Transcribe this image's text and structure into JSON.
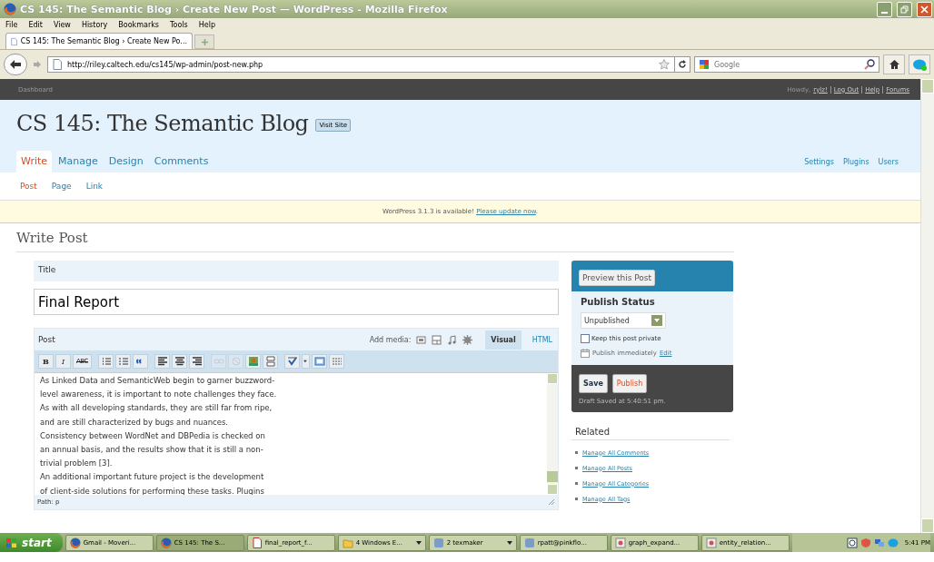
{
  "window": {
    "title": "CS 145: The Semantic Blog › Create New Post — WordPress - Mozilla Firefox"
  },
  "menu": [
    "File",
    "Edit",
    "View",
    "History",
    "Bookmarks",
    "Tools",
    "Help"
  ],
  "tabs": [
    {
      "label": "CS 145: The Semantic Blog › Create New Po...",
      "selected": true
    }
  ],
  "address": {
    "url": "http://riley.caltech.edu/cs145/wp-admin/post-new.php"
  },
  "search": {
    "placeholder": "Google"
  },
  "admin_bar": {
    "dashboard": "Dashboard",
    "greeting": "Howdy,",
    "user": "rylz!",
    "links": [
      "Log Out",
      "Help",
      "Forums"
    ]
  },
  "header": {
    "blog_title": "CS 145: The Semantic Blog",
    "visit_site": "Visit Site"
  },
  "nav_tabs": [
    {
      "label": "Write",
      "selected": true
    },
    {
      "label": "Manage",
      "selected": false
    },
    {
      "label": "Design",
      "selected": false
    },
    {
      "label": "Comments",
      "selected": false
    }
  ],
  "nav_right": [
    "Settings",
    "Plugins",
    "Users"
  ],
  "sub_tabs": [
    {
      "label": "Post",
      "selected": true
    },
    {
      "label": "Page",
      "selected": false
    },
    {
      "label": "Link",
      "selected": false
    }
  ],
  "notice": {
    "text": "WordPress 3.1.3 is available!",
    "link": "Please update now",
    "end": "."
  },
  "page_heading": "Write Post",
  "title_box": {
    "label": "Title",
    "value": "Final Report"
  },
  "post_box": {
    "label": "Post",
    "add_media": "Add media:",
    "editor_tabs": [
      {
        "label": "Visual",
        "selected": true
      },
      {
        "label": "HTML",
        "selected": false
      }
    ],
    "toolbar": [
      {
        "kind": "bold",
        "label": "B",
        "disabled": false
      },
      {
        "kind": "italic",
        "label": "I",
        "disabled": false
      },
      {
        "kind": "strike",
        "label": "ABC",
        "disabled": false
      },
      {
        "kind": "sep"
      },
      {
        "kind": "ul",
        "disabled": false
      },
      {
        "kind": "ol",
        "disabled": false
      },
      {
        "kind": "quote",
        "disabled": false
      },
      {
        "kind": "sep"
      },
      {
        "kind": "left",
        "disabled": false
      },
      {
        "kind": "center",
        "disabled": false
      },
      {
        "kind": "right",
        "disabled": false
      },
      {
        "kind": "sep"
      },
      {
        "kind": "link",
        "disabled": true
      },
      {
        "kind": "unlink",
        "disabled": true
      },
      {
        "kind": "image",
        "disabled": false
      },
      {
        "kind": "more",
        "disabled": false
      },
      {
        "kind": "sep"
      },
      {
        "kind": "spell",
        "disabled": false
      },
      {
        "kind": "caret",
        "disabled": false
      },
      {
        "kind": "fullscreen",
        "disabled": false
      },
      {
        "kind": "kitchen",
        "disabled": false
      }
    ],
    "lines": [
      "As Linked Data and SemanticWeb begin to garner buzzword-",
      "level awareness, it is important to note challenges they face.",
      "As with all developing standards, they are still far from ripe,",
      "and are still characterized by bugs and nuances.",
      "Consistency between WordNet and DBPedia is checked on",
      "an annual basis, and the results show that it is still a non-",
      "trivial problem [3].",
      "An additional important future project is the development",
      "of client-side solutions for performing these tasks. Plugins"
    ],
    "path": "Path: p"
  },
  "publish": {
    "preview": "Preview this Post",
    "heading": "Publish Status",
    "status": "Unpublished",
    "private": {
      "label": "Keep this post private",
      "checked": false
    },
    "schedule": "Publish immediately",
    "edit": "Edit",
    "save": "Save",
    "publish": "Publish",
    "draft_saved": "Draft Saved at 5:40:51 pm."
  },
  "related": {
    "heading": "Related",
    "links": [
      "Manage All Comments",
      "Manage All Posts",
      "Manage All Categories",
      "Manage All Tags"
    ]
  },
  "taskbar": {
    "start": "start",
    "items": [
      {
        "label": "Gmail - Moveri...",
        "kind": "firefox",
        "selected": false,
        "group": false
      },
      {
        "label": "CS 145: The S...",
        "kind": "firefox",
        "selected": true,
        "group": false
      },
      {
        "label": "final_report_f...",
        "kind": "pdf",
        "selected": false,
        "group": false
      },
      {
        "label": "4 Windows E...",
        "kind": "folder",
        "selected": false,
        "group": true
      },
      {
        "label": "2 texmaker",
        "kind": "app",
        "selected": false,
        "group": true
      },
      {
        "label": "rpatt@pinkflo...",
        "kind": "app",
        "selected": false,
        "group": false
      },
      {
        "label": "graph_expand...",
        "kind": "image",
        "selected": false,
        "group": false
      },
      {
        "label": "entity_relation...",
        "kind": "image",
        "selected": false,
        "group": false
      }
    ],
    "clock": "5:41 PM"
  }
}
